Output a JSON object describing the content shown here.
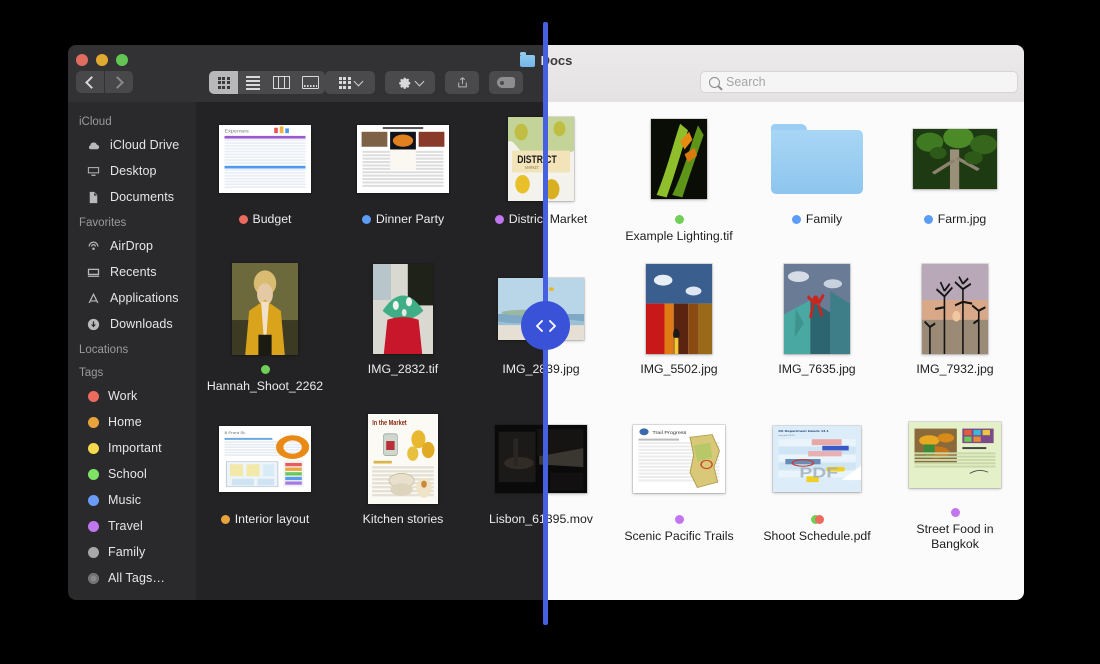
{
  "window": {
    "title": "Docs",
    "traffic_lights": [
      "close",
      "minimize",
      "zoom"
    ]
  },
  "toolbar": {
    "back_label": "Back",
    "forward_label": "Forward",
    "view_modes": [
      {
        "name": "icon-view",
        "selected": true
      },
      {
        "name": "list-view",
        "selected": false
      },
      {
        "name": "column-view",
        "selected": false
      },
      {
        "name": "gallery-view",
        "selected": false
      }
    ],
    "group_label": "Group items",
    "action_label": "Action",
    "share_label": "Share",
    "tag_label": "Edit Tags"
  },
  "search": {
    "placeholder": "Search",
    "value": ""
  },
  "sidebar": {
    "sections": [
      {
        "title": "iCloud",
        "items": [
          {
            "label": "iCloud Drive",
            "icon": "cloud-icon"
          },
          {
            "label": "Desktop",
            "icon": "desktop-icon"
          },
          {
            "label": "Documents",
            "icon": "documents-icon"
          }
        ]
      },
      {
        "title": "Favorites",
        "items": [
          {
            "label": "AirDrop",
            "icon": "airdrop-icon"
          },
          {
            "label": "Recents",
            "icon": "recents-icon"
          },
          {
            "label": "Applications",
            "icon": "applications-icon"
          },
          {
            "label": "Downloads",
            "icon": "downloads-icon"
          }
        ]
      },
      {
        "title": "Locations",
        "items": []
      },
      {
        "title": "Tags",
        "items": [
          {
            "label": "Work",
            "icon": "tag-dot",
            "color": "#ec6b5e"
          },
          {
            "label": "Home",
            "icon": "tag-dot",
            "color": "#e8a33d"
          },
          {
            "label": "Important",
            "icon": "tag-dot",
            "color": "#f5d94e"
          },
          {
            "label": "School",
            "icon": "tag-dot",
            "color": "#7ee265"
          },
          {
            "label": "Music",
            "icon": "tag-dot",
            "color": "#6a9cf7"
          },
          {
            "label": "Travel",
            "icon": "tag-dot",
            "color": "#c176ef"
          },
          {
            "label": "Family",
            "icon": "tag-dot",
            "color": "#a8a8a8"
          },
          {
            "label": "All Tags…",
            "icon": "all-tags-icon",
            "color": "#8a8a8a"
          }
        ]
      }
    ]
  },
  "files": [
    {
      "name": "Budget",
      "kind": "spreadsheet",
      "tags": [
        "#ec6b5e"
      ]
    },
    {
      "name": "Dinner Party",
      "kind": "recipe-doc",
      "tags": [
        "#5b9cf6"
      ]
    },
    {
      "name": "District Market",
      "kind": "poster-citrus",
      "tags": [
        "#c176ef"
      ]
    },
    {
      "name": "Example Lighting.tif",
      "kind": "photo-leaf",
      "tags": [
        "#6fcf56"
      ]
    },
    {
      "name": "Family",
      "kind": "folder",
      "tags": [
        "#5b9cf6"
      ]
    },
    {
      "name": "Farm.jpg",
      "kind": "photo-tree",
      "tags": [
        "#5b9cf6"
      ]
    },
    {
      "name": "Hannah_Shoot_2262",
      "kind": "photo-portrait",
      "tags": [
        "#6fcf56"
      ]
    },
    {
      "name": "IMG_2832.tif",
      "kind": "photo-hat",
      "tags": []
    },
    {
      "name": "IMG_2839.jpg",
      "kind": "photo-beach",
      "tags": []
    },
    {
      "name": "IMG_5502.jpg",
      "kind": "photo-wall",
      "tags": []
    },
    {
      "name": "IMG_7635.jpg",
      "kind": "photo-climber",
      "tags": []
    },
    {
      "name": "IMG_7932.jpg",
      "kind": "photo-sunset",
      "tags": []
    },
    {
      "name": "Interior layout",
      "kind": "floorplan",
      "tags": [
        "#e8a33d"
      ]
    },
    {
      "name": "Kitchen stories",
      "kind": "market-doc",
      "tags": []
    },
    {
      "name": "Lisbon_61395.mov",
      "kind": "video-dark",
      "tags": []
    },
    {
      "name": "Scenic Pacific Trails",
      "kind": "trail-doc",
      "tags": [
        "#c176ef"
      ]
    },
    {
      "name": "Shoot Schedule.pdf",
      "kind": "pdf-schedule",
      "tags": [
        "#6fcf56",
        "#ec6b5e"
      ]
    },
    {
      "name": "Street Food in Bangkok",
      "kind": "bangkok-doc",
      "tags": [
        "#c176ef"
      ]
    }
  ],
  "split_overlay": {
    "handle_icon": "left-right-chevrons-handle",
    "accent_color": "#4560e0",
    "handle_color": "#3a52d8"
  }
}
